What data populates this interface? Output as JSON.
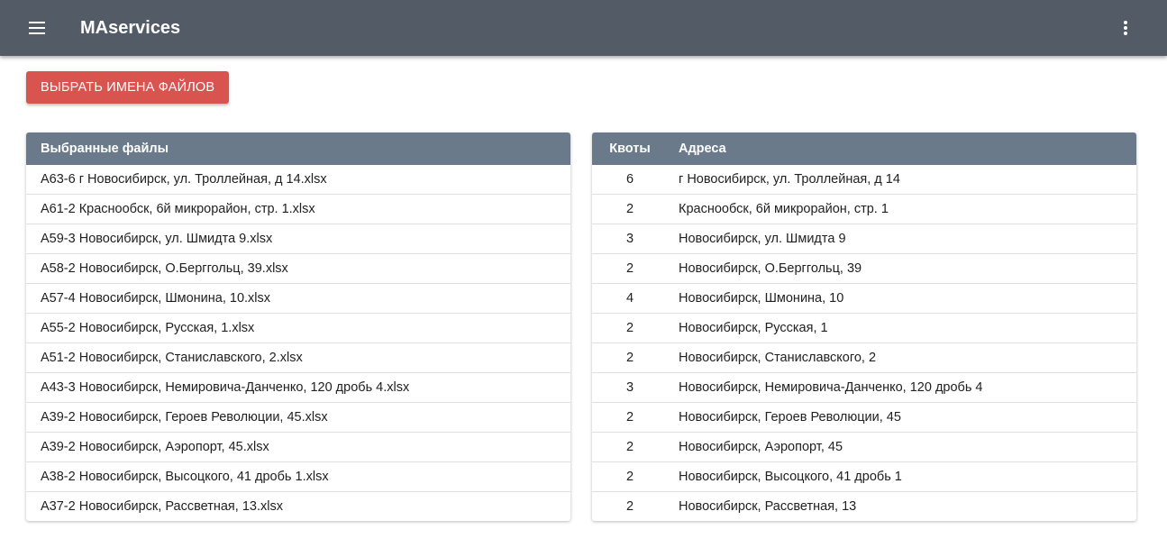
{
  "app_bar": {
    "title": "MAservices",
    "menu_icon": "hamburger-menu-icon",
    "more_icon": "more-vertical-icon",
    "color": "#525b66"
  },
  "actions": {
    "pick_files_label": "ВЫБРАТЬ ИМЕНА ФАЙЛОВ",
    "pick_files_color": "#d9534f"
  },
  "files_table": {
    "header": "Выбранные файлы",
    "rows": [
      "А63-6 г Новосибирск, ул. Троллейная, д 14.xlsx",
      "А61-2 Краснообск, 6й микрорайон, стр. 1.xlsx",
      "А59-3 Новосибирск, ул. Шмидта 9.xlsx",
      "А58-2 Новосибирск, О.Берггольц, 39.xlsx",
      "А57-4 Новосибирск, Шмонина, 10.xlsx",
      "А55-2 Новосибирск, Русская, 1.xlsx",
      "А51-2 Новосибирск, Станиславского, 2.xlsx",
      "А43-3 Новосибирск, Немировича-Данченко, 120 дробь 4.xlsx",
      "А39-2 Новосибирск, Героев Революции, 45.xlsx",
      "А39-2 Новосибирск, Аэропорт, 45.xlsx",
      "А38-2 Новосибирск, Высоцкого, 41 дробь 1.xlsx",
      "А37-2 Новосибирск, Рассветная, 13.xlsx"
    ]
  },
  "quota_table": {
    "headers": {
      "quota": "Квоты",
      "address": "Адреса"
    },
    "header_color": "#6b7a8a",
    "rows": [
      {
        "quota": "6",
        "address": "г Новосибирск, ул. Троллейная, д 14"
      },
      {
        "quota": "2",
        "address": "Краснообск, 6й микрорайон, стр. 1"
      },
      {
        "quota": "3",
        "address": "Новосибирск, ул. Шмидта 9"
      },
      {
        "quota": "2",
        "address": "Новосибирск, О.Берггольц, 39"
      },
      {
        "quota": "4",
        "address": "Новосибирск, Шмонина, 10"
      },
      {
        "quota": "2",
        "address": "Новосибирск, Русская, 1"
      },
      {
        "quota": "2",
        "address": "Новосибирск, Станиславского, 2"
      },
      {
        "quota": "3",
        "address": "Новосибирск, Немировича-Данченко, 120 дробь 4"
      },
      {
        "quota": "2",
        "address": "Новосибирск, Героев Революции, 45"
      },
      {
        "quota": "2",
        "address": "Новосибирск, Аэропорт, 45"
      },
      {
        "quota": "2",
        "address": "Новосибирск, Высоцкого, 41 дробь 1"
      },
      {
        "quota": "2",
        "address": "Новосибирск, Рассветная, 13"
      }
    ]
  }
}
